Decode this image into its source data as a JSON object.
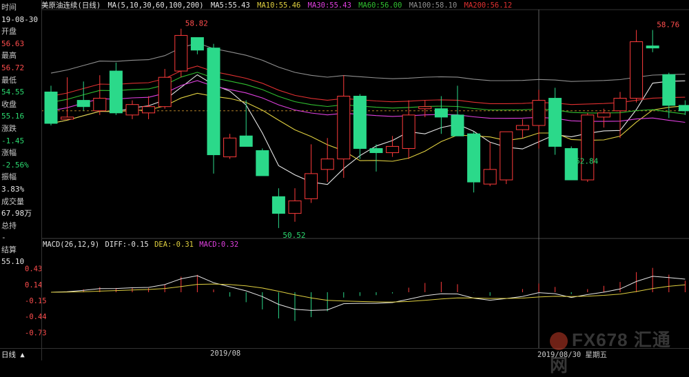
{
  "header": {
    "title": "美原油连续(日线)",
    "ma_label": "MA(5,10,30,60,100,200)",
    "ma5": "MA5:55.43",
    "ma10": "MA10:55.46",
    "ma30": "MA30:55.43",
    "ma60": "MA60:56.00",
    "ma100": "MA100:58.10",
    "ma200": "MA200:56.12"
  },
  "sidebar": [
    {
      "label": "时间",
      "value": "19-08-30",
      "color": "white"
    },
    {
      "label": "开盘",
      "value": "56.63",
      "color": "red"
    },
    {
      "label": "最高",
      "value": "56.72",
      "color": "red"
    },
    {
      "label": "最低",
      "value": "54.55",
      "color": "green"
    },
    {
      "label": "收盘",
      "value": "55.16",
      "color": "green"
    },
    {
      "label": "涨跌",
      "value": "-1.45",
      "color": "green"
    },
    {
      "label": "涨幅",
      "value": "-2.56%",
      "color": "green"
    },
    {
      "label": "振幅",
      "value": "3.83%",
      "color": "white"
    },
    {
      "label": "成交量",
      "value": "67.98万",
      "color": "white"
    },
    {
      "label": "总持",
      "value": "-",
      "color": "white"
    },
    {
      "label": "结算",
      "value": "55.10",
      "color": "white"
    }
  ],
  "macd_header": {
    "label": "MACD(26,12,9)",
    "diff": "DIFF:-0.15",
    "dea": "DEA:-0.31",
    "macd": "MACD:0.32"
  },
  "bottom": {
    "period": "日线",
    "period_icon": "up-triangle-icon",
    "month_label": "2019/08",
    "current_date": "2019/08/30 星期五"
  },
  "watermark": "FX678 汇通网",
  "colors": {
    "up": "#ff3b3b",
    "down": "#2bd98a",
    "ma5": "#e8e8e8",
    "ma10": "#e0d040",
    "ma30": "#e040e0",
    "ma60": "#30c030",
    "ma100": "#909090",
    "ma200": "#e03030"
  },
  "chart_data": {
    "type": "candlestick",
    "title": "美原油连续(日线)",
    "y_ticks_price": [],
    "annotations": [
      {
        "label": "58.82",
        "type": "high"
      },
      {
        "label": "50.52",
        "type": "low"
      },
      {
        "label": "52.84",
        "type": "low"
      },
      {
        "label": "58.76",
        "type": "high"
      }
    ],
    "candles": [
      {
        "o": 55.8,
        "h": 56.1,
        "l": 54.2,
        "c": 54.3
      },
      {
        "o": 54.5,
        "h": 56.5,
        "l": 54.5,
        "c": 54.6
      },
      {
        "o": 55.4,
        "h": 56.3,
        "l": 54.9,
        "c": 55.1
      },
      {
        "o": 54.9,
        "h": 56.6,
        "l": 54.7,
        "c": 55.5
      },
      {
        "o": 56.8,
        "h": 57.2,
        "l": 54.7,
        "c": 54.8
      },
      {
        "o": 54.7,
        "h": 55.4,
        "l": 54.5,
        "c": 55.2
      },
      {
        "o": 54.8,
        "h": 55.6,
        "l": 54.5,
        "c": 55.1
      },
      {
        "o": 55.1,
        "h": 56.9,
        "l": 55.0,
        "c": 56.5
      },
      {
        "o": 56.8,
        "h": 58.82,
        "l": 56.5,
        "c": 58.5
      },
      {
        "o": 58.4,
        "h": 58.4,
        "l": 57.6,
        "c": 57.8
      },
      {
        "o": 57.9,
        "h": 58.1,
        "l": 51.9,
        "c": 52.8
      },
      {
        "o": 52.7,
        "h": 53.8,
        "l": 52.6,
        "c": 53.6
      },
      {
        "o": 53.7,
        "h": 55.4,
        "l": 53.3,
        "c": 53.2
      },
      {
        "o": 53.0,
        "h": 53.1,
        "l": 51.8,
        "c": 51.8
      },
      {
        "o": 50.8,
        "h": 51.2,
        "l": 49.3,
        "c": 50.0
      },
      {
        "o": 50.0,
        "h": 51.2,
        "l": 49.6,
        "c": 50.6
      },
      {
        "o": 50.7,
        "h": 53.3,
        "l": 50.5,
        "c": 51.9
      },
      {
        "o": 52.1,
        "h": 53.6,
        "l": 51.5,
        "c": 52.6
      },
      {
        "o": 52.6,
        "h": 56.6,
        "l": 51.7,
        "c": 55.6
      },
      {
        "o": 55.6,
        "h": 55.7,
        "l": 52.6,
        "c": 53.1
      },
      {
        "o": 53.1,
        "h": 53.3,
        "l": 52.0,
        "c": 52.9
      },
      {
        "o": 52.9,
        "h": 53.7,
        "l": 52.7,
        "c": 53.2
      },
      {
        "o": 53.1,
        "h": 55.4,
        "l": 52.6,
        "c": 54.7
      },
      {
        "o": 55.0,
        "h": 55.4,
        "l": 54.6,
        "c": 55.1
      },
      {
        "o": 55.0,
        "h": 55.6,
        "l": 53.8,
        "c": 54.6
      },
      {
        "o": 54.7,
        "h": 56.1,
        "l": 54.6,
        "c": 53.7
      },
      {
        "o": 53.8,
        "h": 53.9,
        "l": 51.0,
        "c": 51.5
      },
      {
        "o": 51.4,
        "h": 53.4,
        "l": 51.3,
        "c": 52.1
      },
      {
        "o": 51.6,
        "h": 53.9,
        "l": 51.4,
        "c": 53.9
      },
      {
        "o": 54.0,
        "h": 54.5,
        "l": 53.6,
        "c": 54.2
      },
      {
        "o": 54.2,
        "h": 55.9,
        "l": 53.1,
        "c": 55.4
      },
      {
        "o": 55.5,
        "h": 56.0,
        "l": 52.8,
        "c": 53.2
      },
      {
        "o": 53.1,
        "h": 53.2,
        "l": 52.84,
        "c": 51.6
      },
      {
        "o": 51.6,
        "h": 54.8,
        "l": 51.5,
        "c": 54.7
      },
      {
        "o": 54.6,
        "h": 55.0,
        "l": 54.1,
        "c": 54.8
      },
      {
        "o": 54.9,
        "h": 55.8,
        "l": 53.6,
        "c": 55.5
      },
      {
        "o": 55.5,
        "h": 58.76,
        "l": 55.3,
        "c": 58.2
      },
      {
        "o": 58.0,
        "h": 58.76,
        "l": 57.7,
        "c": 57.9
      },
      {
        "o": 56.63,
        "h": 56.72,
        "l": 54.55,
        "c": 55.16
      },
      {
        "o": 55.16,
        "h": 55.4,
        "l": 54.7,
        "c": 54.9
      }
    ],
    "macd": {
      "y_ticks": [
        "0.43",
        "0.14",
        "-0.15",
        "-0.44",
        "-0.73"
      ],
      "y_tick_values": [
        0.43,
        0.14,
        -0.15,
        -0.44,
        -0.73
      ]
    }
  }
}
